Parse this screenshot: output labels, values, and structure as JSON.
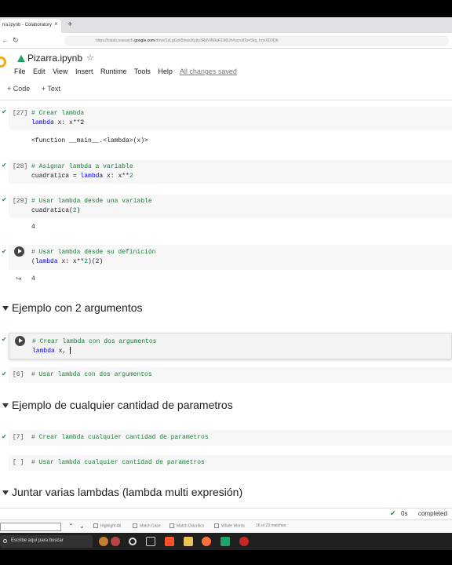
{
  "browser": {
    "tab_title": "rra.ipynb - Colaboratory",
    "tab_close": "×",
    "new_tab": "+",
    "url_prefix": "https://colab.research.",
    "url_domain": "google.com",
    "url_rest": "/drive/1oLgGxk5inwuXytty3RdVtN9uF2Ji6Uh#scrollTo=5kq_hnvXD3Qh"
  },
  "colab": {
    "notebook_title": "Pizarra.ipynb",
    "star": "☆",
    "menu": [
      "File",
      "Edit",
      "View",
      "Insert",
      "Runtime",
      "Tools",
      "Help"
    ],
    "saved_status": "All changes saved",
    "toolbar": {
      "code": "+ Code",
      "text": "+ Text"
    }
  },
  "cells": {
    "c27": {
      "exec": "[27]",
      "comment": "# Crear lambda",
      "line2_kw": "lambda",
      "line2_rest": " x: x**2",
      "output": "<function __main__.<lambda>(x)>"
    },
    "c28": {
      "exec": "[28]",
      "comment": "# Asignar lambda a variable",
      "line2_pre": "cuadratica = ",
      "line2_kw": "lambda",
      "line2_rest": " x: x**",
      "line2_num": "2"
    },
    "c29": {
      "exec": "[29]",
      "comment": "# Usar lambda desde una variable",
      "line2_pre": "cuadratica(",
      "line2_num": "2",
      "line2_post": ")",
      "output": "4"
    },
    "c30": {
      "comment": "# Usar lambda desde su definición",
      "line2_pre": "(",
      "line2_kw": "lambda",
      "line2_rest": " x: x**",
      "line2_num": "2",
      "line2_post": ")(2)",
      "output": "4"
    },
    "c31": {
      "comment": "# Crear lambda con dos argumentos",
      "line2_kw": "lambda",
      "line2_rest": " x, "
    },
    "c6": {
      "exec": "[6]",
      "comment": "# Usar lambda con dos argumentos"
    },
    "c7": {
      "exec": "[7]",
      "comment": "# Crear lambda cualquier cantidad de parametros"
    },
    "c8": {
      "exec": "[ ]",
      "comment": "# Usar lambda cualquier cantidad de parametros"
    }
  },
  "sections": {
    "s1": "Ejemplo con 2 argumentos",
    "s2": "Ejemplo de cualquier cantidad de parametros",
    "s3": "Juntar varias lambdas (lambda multi expresión)"
  },
  "status": {
    "time": "0s",
    "state": "completed"
  },
  "findbar": {
    "options": [
      "Highlight All",
      "Match Case",
      "Match Diacritics",
      "Whole Words"
    ],
    "count": "16 of 23 matches"
  },
  "taskbar": {
    "search_placeholder": "Escribe aquí para buscar"
  },
  "colors": {
    "comment": "#188038",
    "keyword": "#0000ff",
    "number": "#098658",
    "check": "#1e8e3e"
  }
}
